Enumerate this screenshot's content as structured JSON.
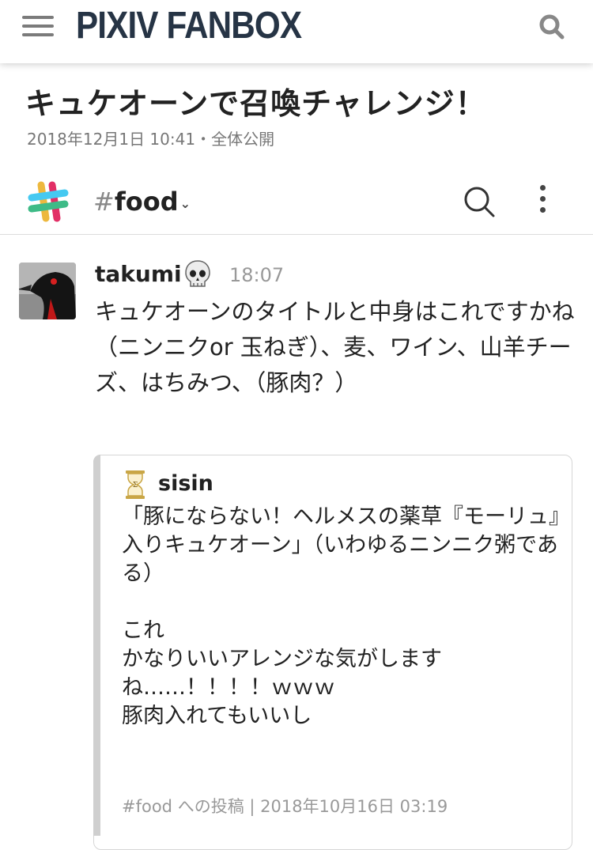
{
  "app": {
    "brand": "PIXIV FANBOX",
    "icons": {
      "menu": "hamburger-menu-icon",
      "search": "search-icon"
    }
  },
  "post": {
    "title": "キュケオーンで召喚チャレンジ！",
    "meta": "2018年12月1日 10:41・全体公開"
  },
  "channel": {
    "hash": "#",
    "name": "food",
    "caret": "⌄",
    "icons": {
      "logo": "slack-logo-icon",
      "search": "search-icon",
      "more": "more-vertical-icon"
    }
  },
  "message": {
    "username": "takumi",
    "emoji": "skull-emoji",
    "time": "18:07",
    "text": "キュケオーンのタイトルと中身はこれですかね\n（ニンニクor 玉ねぎ）、麦、ワイン、山羊チーズ、はちみつ、（豚肉？）"
  },
  "shared": {
    "username": "sisin",
    "text": "「豚にならない！ヘルメスの薬草『モーリュ』入りキュケオーン」（いわゆるニンニク粥である）\n\nこれ\nかなりいいアレンジな気がしますね……！！！！ｗｗｗ\n豚肉入れてもいいし",
    "footer": "#food への投稿 | 2018年10月16日 03:19"
  },
  "colors": {
    "brand_text": "#263445",
    "muted": "#999999",
    "slack_blue": "#36C5F0",
    "slack_green": "#2EB67D",
    "slack_yellow": "#ECB22E",
    "slack_red": "#E01E5A"
  }
}
